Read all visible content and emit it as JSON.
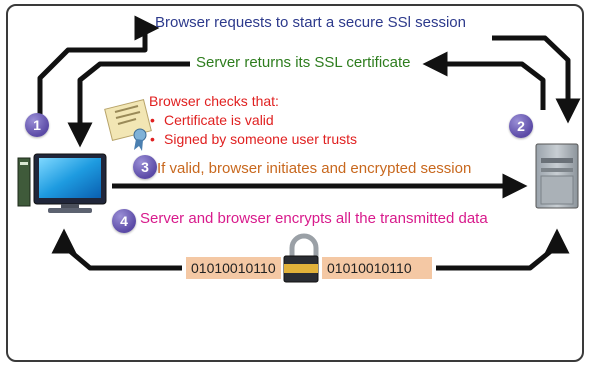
{
  "labels": {
    "request": "Browser requests to start a secure SSl session",
    "certificate_return": "Server returns its SSL certificate",
    "checks": "Browser checks that:",
    "check_valid": "Certificate is valid",
    "check_signed": "Signed by someone user trusts",
    "initiate": "If valid, browser initiates and encrypted session",
    "encrypt": "Server and browser encrypts all the transmitted data",
    "binary_left": "01010010110",
    "binary_right": "01010010110"
  },
  "steps": [
    "1",
    "2",
    "3",
    "4"
  ],
  "colors": {
    "request": "#2d3a8c",
    "certificate_return": "#2e7d1e",
    "checks": "#e02020",
    "initiate": "#c8681e",
    "encrypt": "#d81b8c",
    "step_badge": "#5b4aa6",
    "binary_bg": "#f4c8a4"
  },
  "icons": [
    "computer-icon",
    "server-icon",
    "certificate-icon",
    "padlock-icon"
  ]
}
